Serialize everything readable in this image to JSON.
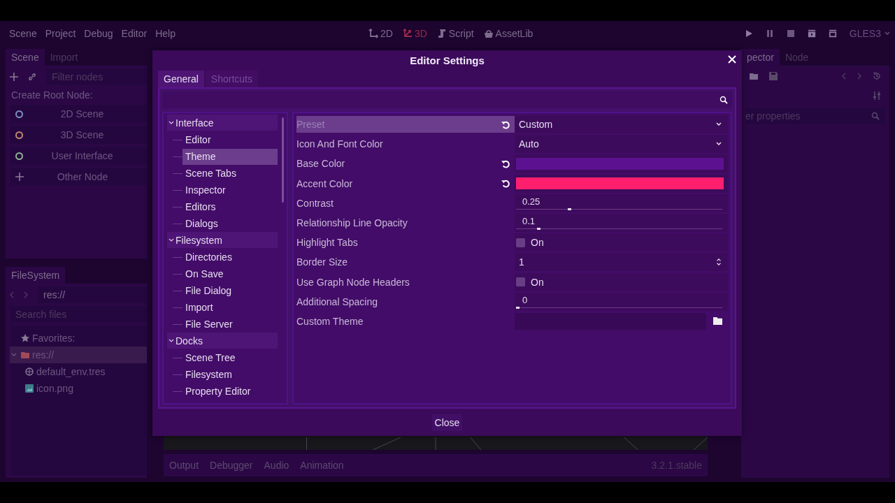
{
  "menu_bar": {
    "menus": [
      "Scene",
      "Project",
      "Debug",
      "Editor",
      "Help"
    ],
    "workspaces": [
      {
        "label": "2D",
        "kind": "planar",
        "selected": false
      },
      {
        "label": "3D",
        "kind": "spatial",
        "selected": true
      },
      {
        "label": "Script",
        "kind": "script",
        "selected": false
      },
      {
        "label": "AssetLib",
        "kind": "assetlib",
        "selected": false
      }
    ],
    "renderer": "GLES3"
  },
  "scene_dock": {
    "tabs": [
      {
        "label": "Scene",
        "selected": true
      },
      {
        "label": "Import",
        "selected": false
      }
    ],
    "filter_placeholder": "Filter nodes",
    "heading": "Create Root Node:",
    "root_buttons": [
      {
        "label": "2D Scene",
        "kind": "circle",
        "color": "#7d8fc4"
      },
      {
        "label": "3D Scene",
        "kind": "circle",
        "color": "#c08a6e"
      },
      {
        "label": "User Interface",
        "kind": "circle",
        "color": "#8fb395"
      },
      {
        "label": "Other Node",
        "kind": "plus"
      }
    ]
  },
  "filesystem_dock": {
    "title": "FileSystem",
    "path": "res://",
    "search_placeholder": "Search files",
    "tree": [
      {
        "label": "Favorites:",
        "kind": "favorites",
        "selected": false
      },
      {
        "label": "res://",
        "kind": "folder",
        "selected": true,
        "expanded": true,
        "children": [
          {
            "label": "default_env.tres",
            "kind": "resource",
            "selected": false
          },
          {
            "label": "icon.png",
            "kind": "image",
            "selected": false
          }
        ]
      }
    ]
  },
  "inspector_dock": {
    "tabs": [
      {
        "label": "pector",
        "selected": true
      },
      {
        "label": "Node",
        "selected": false
      }
    ],
    "filter_placeholder": "er properties"
  },
  "bottom_panel": {
    "tabs": [
      "Output",
      "Debugger",
      "Audio",
      "Animation"
    ],
    "version": "3.2.1.stable"
  },
  "dialog": {
    "title": "Editor Settings",
    "tabs": [
      {
        "label": "General",
        "selected": true
      },
      {
        "label": "Shortcuts",
        "selected": false
      }
    ],
    "sections": [
      {
        "label": "Interface",
        "expanded": true,
        "selected": false,
        "children": [
          {
            "label": "Editor",
            "selected": false
          },
          {
            "label": "Theme",
            "selected": true
          },
          {
            "label": "Scene Tabs",
            "selected": false
          },
          {
            "label": "Inspector",
            "selected": false
          },
          {
            "label": "Editors",
            "selected": false
          },
          {
            "label": "Dialogs",
            "selected": false
          }
        ]
      },
      {
        "label": "Filesystem",
        "expanded": true,
        "selected": false,
        "children": [
          {
            "label": "Directories",
            "selected": false
          },
          {
            "label": "On Save",
            "selected": false
          },
          {
            "label": "File Dialog",
            "selected": false
          },
          {
            "label": "Import",
            "selected": false
          },
          {
            "label": "File Server",
            "selected": false
          }
        ]
      },
      {
        "label": "Docks",
        "expanded": true,
        "selected": false,
        "children": [
          {
            "label": "Scene Tree",
            "selected": false
          },
          {
            "label": "Filesystem",
            "selected": false
          },
          {
            "label": "Property Editor",
            "selected": false
          }
        ]
      }
    ],
    "properties": [
      {
        "label": "Preset",
        "kind": "dropdown",
        "value": "Custom",
        "revertable": true,
        "selected": true
      },
      {
        "label": "Icon And Font Color",
        "kind": "dropdown",
        "value": "Auto",
        "revertable": false,
        "selected": false
      },
      {
        "label": "Base Color",
        "kind": "color",
        "color": "#5c1191",
        "revertable": true,
        "selected": false
      },
      {
        "label": "Accent Color",
        "kind": "color",
        "color": "#ff1f6e",
        "revertable": true,
        "selected": false
      },
      {
        "label": "Contrast",
        "kind": "slider",
        "value": "0.25",
        "level": 0.25,
        "revertable": false,
        "selected": false
      },
      {
        "label": "Relationship Line Opacity",
        "kind": "slider",
        "value": "0.1",
        "level": 0.1,
        "revertable": false,
        "selected": false
      },
      {
        "label": "Highlight Tabs",
        "kind": "check",
        "value": "On",
        "checked": false,
        "revertable": false,
        "selected": false
      },
      {
        "label": "Border Size",
        "kind": "spin",
        "value": "1",
        "revertable": false,
        "selected": false
      },
      {
        "label": "Use Graph Node Headers",
        "kind": "check",
        "value": "On",
        "checked": false,
        "revertable": false,
        "selected": false
      },
      {
        "label": "Additional Spacing",
        "kind": "slider",
        "value": "0",
        "level": 0,
        "revertable": false,
        "selected": false
      },
      {
        "label": "Custom Theme",
        "kind": "file",
        "revertable": false,
        "selected": false
      }
    ],
    "close_button": "Close"
  }
}
